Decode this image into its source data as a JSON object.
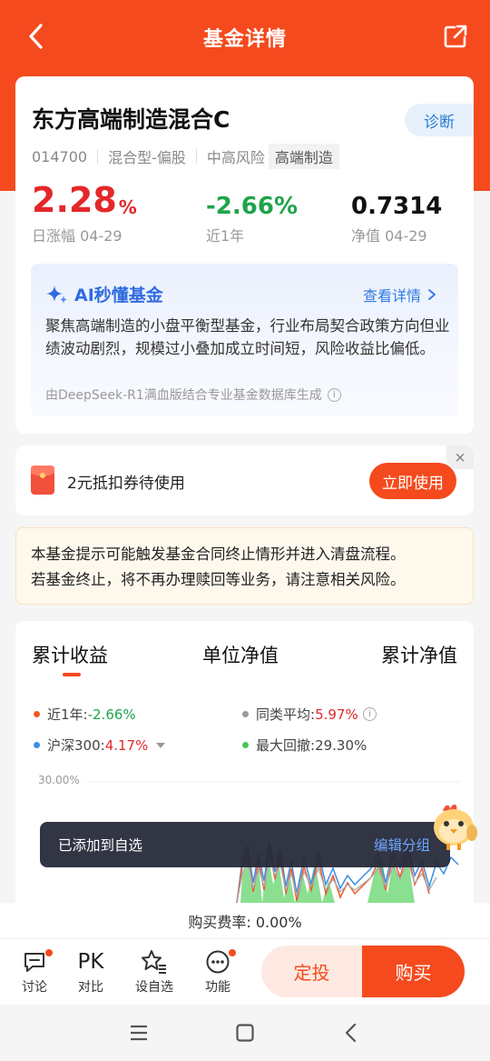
{
  "header": {
    "title": "基金详情",
    "back_icon": "chevron-left-icon",
    "share_icon": "share-icon",
    "bg": "#f54a1e"
  },
  "fund": {
    "name": "东方高端制造混合C",
    "diagnose_label": "诊断",
    "code": "014700",
    "type": "混合型-偏股",
    "risk": "中高风险",
    "theme": "高端制造",
    "daily_change": "2.28",
    "daily_change_unit": "%",
    "daily_label": "日涨幅 04-29",
    "year_change": "-2.66%",
    "year_label": "近1年",
    "nav": "0.7314",
    "nav_label": "净值 04-29"
  },
  "ai": {
    "title": "AI秒懂基金",
    "more": "查看详情",
    "summary": "聚焦高端制造的小盘平衡型基金，行业布局契合政策方向但业绩波动剧烈，规模过小叠加成立时间短，风险收益比偏低。",
    "source": "由DeepSeek-R1满血版结合专业基金数据库生成",
    "info_glyph": "i"
  },
  "coupon": {
    "text": "2元抵扣券待使用",
    "button": "立即使用",
    "close": "×"
  },
  "notice": {
    "line1": "本基金提示可能触发基金合同终止情形并进入清盘流程。",
    "line2": "若基金终止，将不再办理赎回等业务，请注意相关风险。"
  },
  "chart": {
    "tabs": [
      "累计收益",
      "单位净值",
      "累计净值"
    ],
    "legend": {
      "fund_label": "近1年:",
      "fund_value": "-2.66%",
      "peer_label": "同类平均:",
      "peer_value": "5.97%",
      "index_label": "沪深300:",
      "index_value": "4.17%",
      "drawdown_label": "最大回撤:",
      "drawdown_value": "29.30%"
    },
    "y_label_top": "30.00%",
    "colors": {
      "fund": "#f05a28",
      "peer": "#999999",
      "index": "#3a8ee6",
      "drawdown": "#49c45a"
    }
  },
  "toast": {
    "text": "已添加到自选",
    "action": "编辑分组"
  },
  "fee": {
    "text": "购买费率: 0.00%"
  },
  "bottom": {
    "items": [
      {
        "label": "讨论",
        "icon": "chat-icon"
      },
      {
        "label": "对比",
        "icon": "PK"
      },
      {
        "label": "设自选",
        "icon": "star-list-icon"
      },
      {
        "label": "功能",
        "icon": "more-icon"
      }
    ],
    "dingtou": "定投",
    "buy": "购买"
  }
}
